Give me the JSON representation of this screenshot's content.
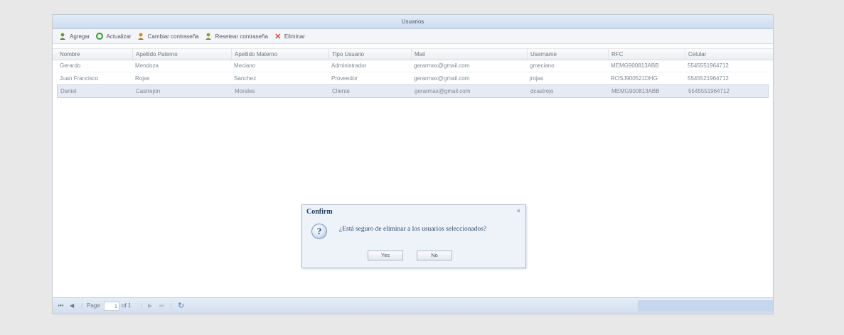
{
  "window": {
    "title": "Usuarios"
  },
  "toolbar": {
    "buttons": [
      {
        "label": "Agregar",
        "icon": "user-add-icon"
      },
      {
        "label": "Actualizar",
        "icon": "refresh-icon"
      },
      {
        "label": "Cambiar contraseña",
        "icon": "user-key-icon"
      },
      {
        "label": "Resetear contraseña",
        "icon": "user-reset-icon"
      },
      {
        "label": "Eliminar",
        "icon": "delete-x-icon"
      }
    ]
  },
  "grid": {
    "columns": [
      "Nombre",
      "Apellido Paterno",
      "Apellido Materno",
      "Tipo Usuario",
      "Mail",
      "Username",
      "RFC",
      "Celular"
    ],
    "rows": [
      [
        "Gerardo",
        "Mendoza",
        "Meciano",
        "Administrador",
        "gerarmax@gmail.com",
        "gmeciano",
        "MEMG900813ABB",
        "5545551964712"
      ],
      [
        "Juan Francisco",
        "Rojas",
        "Sanchez",
        "Proveedor",
        "gerarmax@gmail.com",
        "jrojas",
        "ROSJ900521DHG",
        "5545521964712"
      ],
      [
        "Daniel",
        "Castrejon",
        "Morales",
        "Cliente",
        "gerarmax@gmail.com",
        "dcastrejo",
        "MEMG900813ABB",
        "5545551964712"
      ]
    ],
    "selected_row": 2
  },
  "pager": {
    "page_label": "Page",
    "page_value": "1",
    "of_label": "of 1"
  },
  "dialog": {
    "title": "Confirm",
    "message": "¿Está seguro de eliminar a los usuarios seleccionados?",
    "yes_label": "Yes",
    "no_label": "No",
    "close_glyph": "×",
    "icon": "question-icon"
  },
  "colors": {
    "titlebar": "#cfdcef",
    "selected_row": "#e6ebf3",
    "dialog_title": "#1f3f6e",
    "delete_icon": "#d9463a"
  }
}
